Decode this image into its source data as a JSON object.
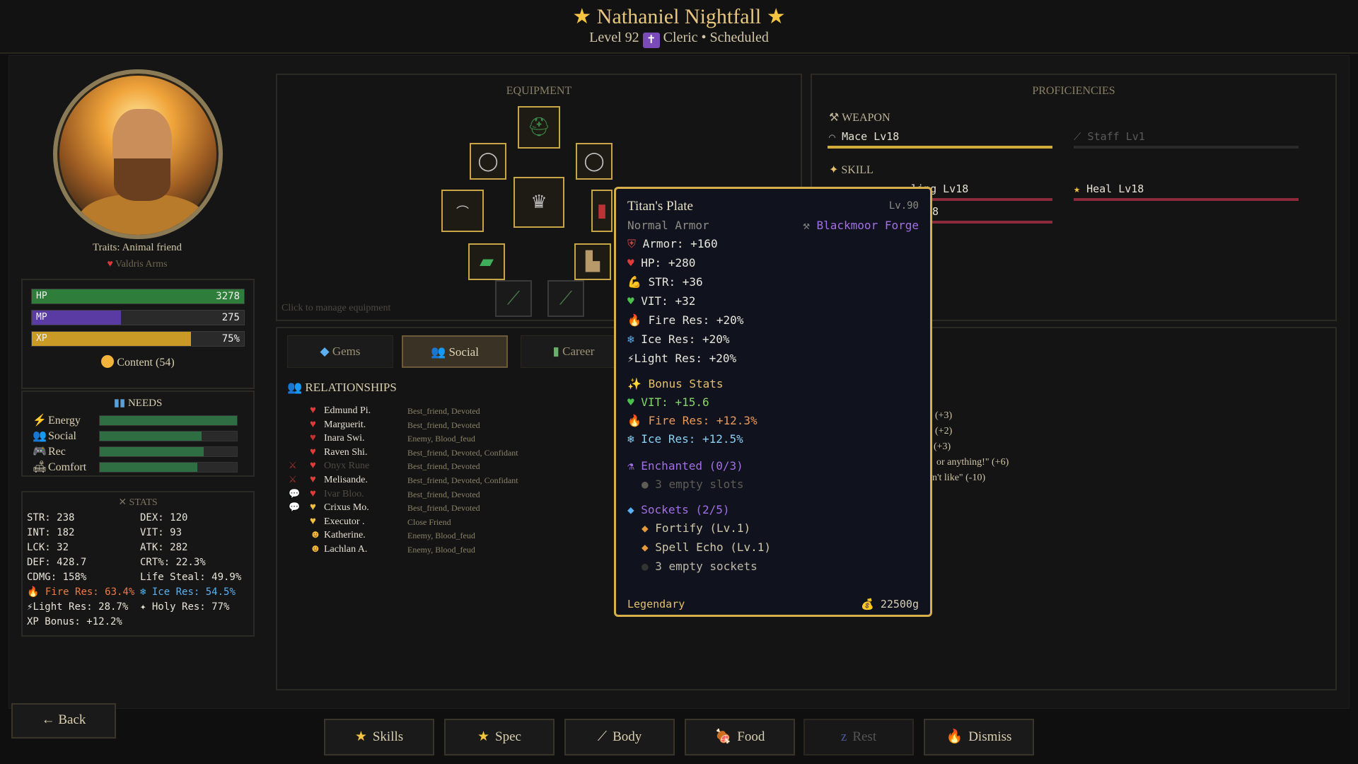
{
  "header": {
    "name": "Nathaniel Nightfall",
    "subtitle_level": "Level 92",
    "class_icon": "✝",
    "subtitle_rest": "Cleric • Scheduled"
  },
  "profile": {
    "traits": "Traits: Animal friend",
    "link": "Valdris Arms"
  },
  "vitals": {
    "hp": {
      "label": "HP",
      "value": "3278",
      "fill": 1.0,
      "color": "#2f7d3a"
    },
    "mp": {
      "label": "MP",
      "value": "275",
      "fill": 0.42,
      "color": "#5a3aa3"
    },
    "xp": {
      "label": "XP",
      "value": "75%",
      "fill": 0.75,
      "color": "#c99a26"
    },
    "mood": "Content (54)"
  },
  "needs": {
    "title": "NEEDS",
    "items": [
      {
        "label": "Energy",
        "icon": "⚡",
        "fill": 1.0
      },
      {
        "label": "Social",
        "icon": "👥",
        "fill": 0.74
      },
      {
        "label": "Rec",
        "icon": "🎮",
        "fill": 0.76
      },
      {
        "label": "Comfort",
        "icon": "🛋",
        "fill": 0.71
      }
    ]
  },
  "stats": {
    "title": "STATS",
    "str": "STR: 238",
    "dex": "DEX: 120",
    "int": "INT: 182",
    "vit": "VIT: 93",
    "lck": "LCK: 32",
    "atk": "ATK: 282",
    "def": "DEF: 428.7",
    "crt": "CRT%: 22.3%",
    "cdmg": "CDMG: 158%",
    "steal": "Life Steal: 49.9%",
    "fire": "Fire Res: 63.4%",
    "ice": "Ice Res: 54.5%",
    "light": "Light Res: 28.7%",
    "holy": "Holy Res: 77%",
    "xpbonus": "XP Bonus: +12.2%"
  },
  "equipment": {
    "title": "EQUIPMENT",
    "hint": "Click to manage equipment"
  },
  "proficiencies": {
    "title": "PROFICIENCIES",
    "weapon_label": "WEAPON",
    "skill_label": "SKILL",
    "mace": "Mace Lv18",
    "staff": "Staff Lv1",
    "skill_left": "ling Lv18",
    "skill_left2": "8",
    "heal": "Heal Lv18"
  },
  "tabs": {
    "gems": "Gems",
    "social": "Social",
    "career": "Career"
  },
  "relationships": {
    "title": "RELATIONSHIPS",
    "rows": [
      {
        "name": "Edmund Pi.",
        "tags": "Best_friend, Devoted",
        "dim": false,
        "prefix": "",
        "icon": "♥",
        "color": "#e03a3a"
      },
      {
        "name": "Marguerit.",
        "tags": "Best_friend, Devoted",
        "dim": false,
        "prefix": "",
        "icon": "♥",
        "color": "#e03a3a"
      },
      {
        "name": "Inara Swi.",
        "tags": "Enemy, Blood_feud",
        "dim": false,
        "prefix": "",
        "icon": "♥",
        "color": "#c23030"
      },
      {
        "name": "Raven Shi.",
        "tags": "Best_friend, Devoted, Confidant",
        "dim": false,
        "prefix": "",
        "icon": "♥",
        "color": "#e03a3a"
      },
      {
        "name": "Onyx Rune",
        "tags": "Best_friend, Devoted",
        "dim": true,
        "prefix": "⚔",
        "icon": "♥",
        "color": "#e03a3a"
      },
      {
        "name": "Melisande.",
        "tags": "Best_friend, Devoted, Confidant",
        "dim": false,
        "prefix": "⚔",
        "icon": "♥",
        "color": "#e03a3a"
      },
      {
        "name": "Ivar Bloo.",
        "tags": "Best_friend, Devoted",
        "dim": true,
        "prefix": "💬",
        "icon": "♥",
        "color": "#e03a3a"
      },
      {
        "name": "Crixus Mo.",
        "tags": "Best_friend, Devoted",
        "dim": false,
        "prefix": "💬",
        "icon": "♥",
        "color": "#f2c040"
      },
      {
        "name": "Executor .",
        "tags": "Close Friend",
        "dim": false,
        "prefix": "",
        "icon": "♥",
        "color": "#f2c040"
      },
      {
        "name": "Katherine.",
        "tags": "Enemy, Blood_feud",
        "dim": false,
        "prefix": "",
        "icon": "☻",
        "color": "#f2b43a"
      },
      {
        "name": "Lachlan A.",
        "tags": "Enemy, Blood_feud",
        "dim": false,
        "prefix": "",
        "icon": "☻",
        "color": "#f2b43a"
      }
    ]
  },
  "opinions": {
    "o1": "(+3)",
    "o2": "' (+2)",
    "o3": "(+3)",
    "o4": "or anything!\" (+6)",
    "o5": "n't like\" (-10)"
  },
  "tooltip": {
    "name": "Titan's Plate",
    "level": "Lv.90",
    "type": "Normal Armor",
    "forge": "Blackmoor Forge",
    "armor": "Armor: +160",
    "hp": "HP: +280",
    "str": "STR: +36",
    "vit": "VIT: +32",
    "fire": "Fire Res: +20%",
    "ice": "Ice Res: +20%",
    "light": "Light Res: +20%",
    "bonus_title": "Bonus Stats",
    "b_vit": "VIT: +15.6",
    "b_fire": "Fire Res: +12.3%",
    "b_ice": "Ice Res: +12.5%",
    "ench_title": "Enchanted (0/3)",
    "ench_empty": "3 empty slots",
    "sock_title": "Sockets (2/5)",
    "sock1": "Fortify (Lv.1)",
    "sock2": "Spell Echo (Lv.1)",
    "sock_empty": "3 empty sockets",
    "rarity": "Legendary",
    "price": "22500g"
  },
  "actions": {
    "back": "← Back",
    "skills": "Skills",
    "spec": "Spec",
    "body": "Body",
    "food": "Food",
    "rest": "Rest",
    "dismiss": "Dismiss"
  }
}
